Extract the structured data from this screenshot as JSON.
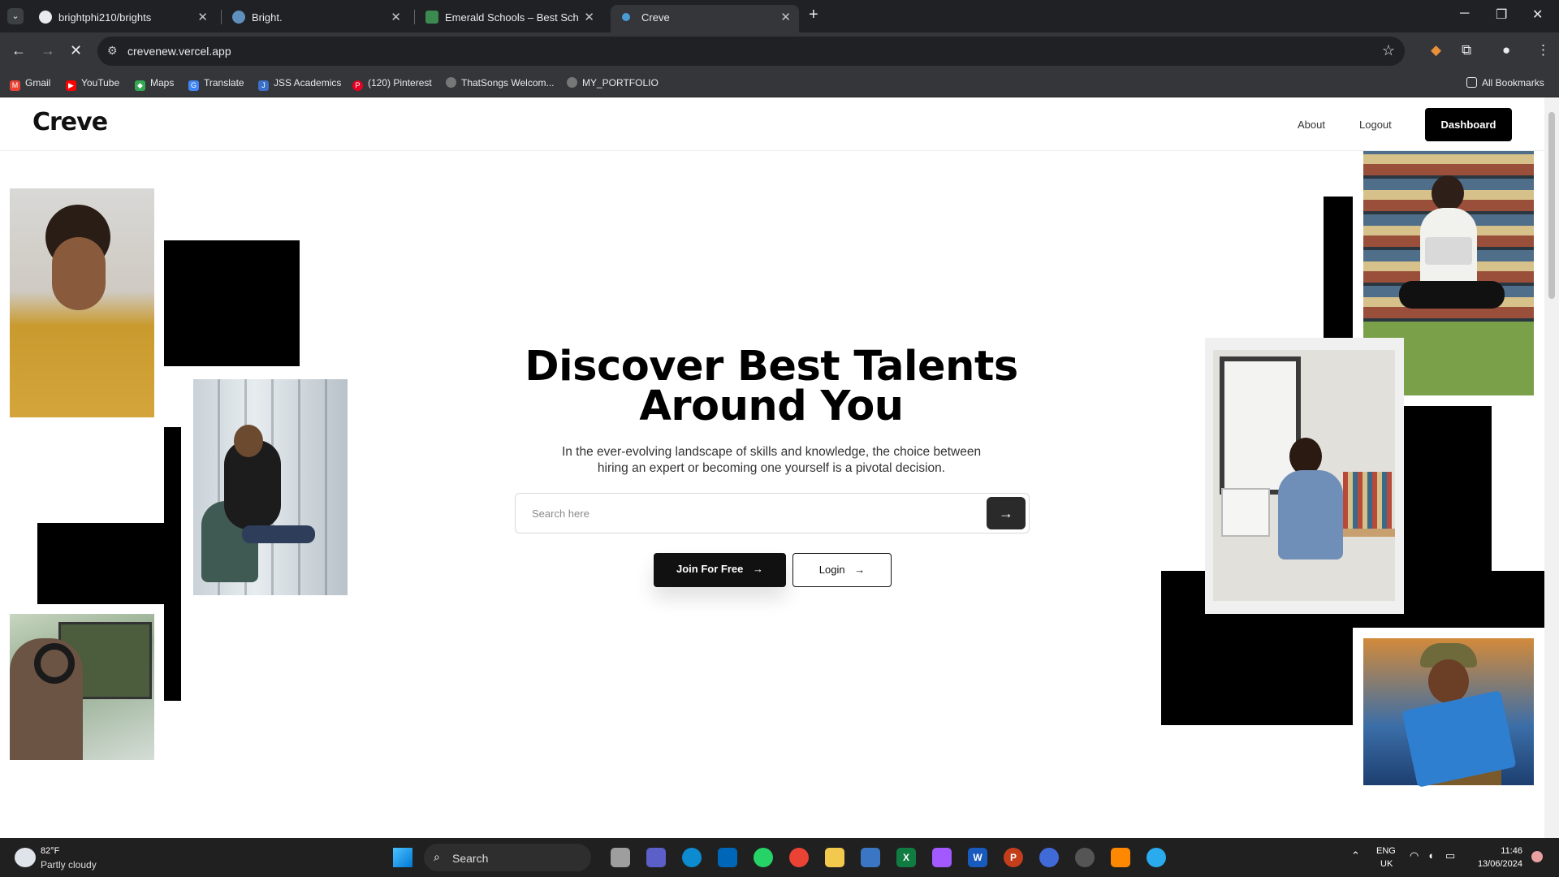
{
  "browser": {
    "tabs": [
      {
        "title": "brightphi210/brights",
        "active": false
      },
      {
        "title": "Bright.",
        "active": false
      },
      {
        "title": "Emerald Schools – Best School",
        "active": false
      },
      {
        "title": "Creve",
        "active": true
      }
    ],
    "url": "crevenew.vercel.app",
    "bookmarks": [
      "Gmail",
      "YouTube",
      "Maps",
      "Translate",
      "JSS Academics",
      "(120) Pinterest",
      "ThatSongs Welcom...",
      "MY_PORTFOLIO"
    ],
    "all_bookmarks": "All Bookmarks"
  },
  "site": {
    "logo": "Creve",
    "nav": {
      "about": "About",
      "logout": "Logout",
      "dashboard": "Dashboard"
    },
    "hero": {
      "title": "Discover Best Talents Around You",
      "subtitle": "In the ever-evolving landscape of skills and knowledge, the choice between hiring an expert or becoming one yourself is a pivotal decision.",
      "search_placeholder": "Search here",
      "join_label": "Join For Free",
      "login_label": "Login"
    }
  },
  "taskbar": {
    "weather_temp": "82°F",
    "weather_desc": "Partly cloudy",
    "search_label": "Search",
    "lang_1": "ENG",
    "lang_2": "UK",
    "time": "11:46",
    "date": "13/06/2024"
  }
}
